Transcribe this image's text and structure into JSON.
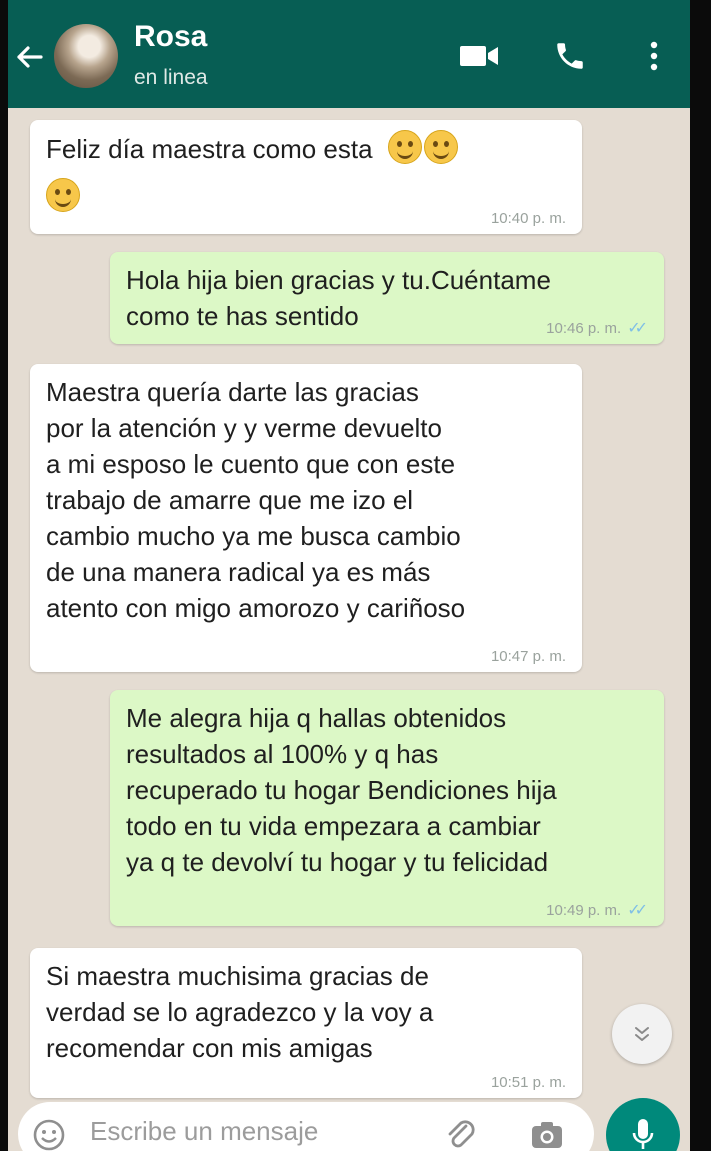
{
  "header": {
    "contact_name": "Rosa",
    "status": "en linea"
  },
  "messages": [
    {
      "direction": "in",
      "text": "Feliz día maestra como esta",
      "emoji_after_text": 2,
      "emoji_second_line": 1,
      "time": "10:40 p. m."
    },
    {
      "direction": "out",
      "text": "Hola hija bien gracias y tu.Cuéntame\ncomo te has sentido",
      "time": "10:46 p. m.",
      "read": true
    },
    {
      "direction": "in",
      "text": "Maestra quería darte las gracias\npor la atención y y verme devuelto\na mi esposo le cuento que con este\ntrabajo de amarre que me izo el\ncambio mucho ya me busca cambio\nde una manera radical ya es más\natento con migo amorozo y cariñoso",
      "time": "10:47 p. m."
    },
    {
      "direction": "out",
      "text": "Me alegra hija q hallas obtenidos\nresultados al 100% y q has\nrecuperado tu hogar Bendiciones hija\ntodo en tu vida empezara a cambiar\nya q te devolví tu hogar y tu felicidad",
      "time": "10:49 p. m.",
      "read": true
    },
    {
      "direction": "in",
      "text": "Si maestra muchisima gracias de\nverdad se lo agradezco y la voy a\nrecomendar con mis amigas",
      "time": "10:51 p. m."
    }
  ],
  "input": {
    "placeholder": "Escribe un mensaje"
  },
  "icons": {
    "back": "arrow-left-icon",
    "video": "video-camera-icon",
    "call": "phone-icon",
    "menu": "more-vertical-icon",
    "scroll": "chevron-double-down-icon",
    "emoji": "smiley-icon",
    "attach": "paperclip-icon",
    "camera": "camera-icon",
    "mic": "microphone-icon"
  },
  "colors": {
    "header": "#075e54",
    "chat_background": "#e4dcd2",
    "incoming_bubble": "#ffffff",
    "outgoing_bubble": "#dcf8c6",
    "read_ticks": "#7fbfe6",
    "mic_button": "#00897b"
  }
}
